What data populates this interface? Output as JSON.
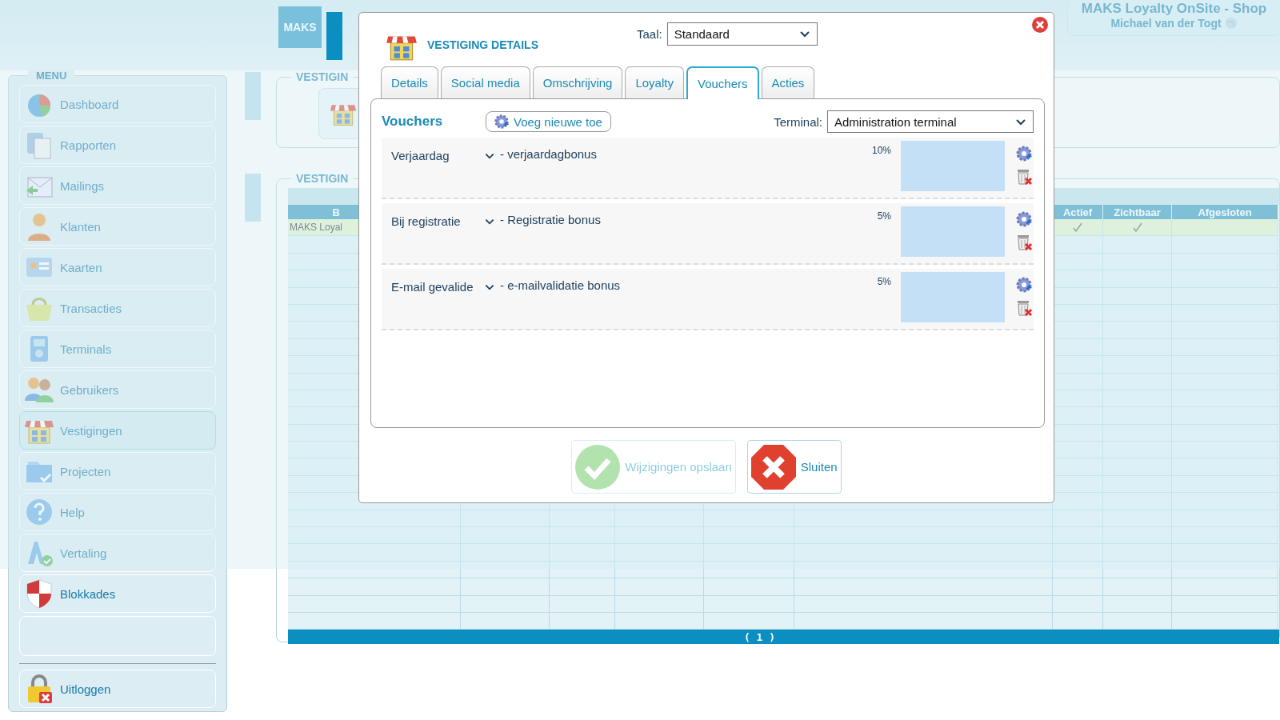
{
  "header": {
    "nav_button": "MAKS",
    "app_title": "MAKS Loyalty OnSite - Shop",
    "user_name": "Michael van der Togt"
  },
  "sidebar": {
    "title": "MENU",
    "items": [
      {
        "kind": "link",
        "label": "Dashboard",
        "selected": false
      },
      {
        "kind": "link",
        "label": "Rapporten",
        "selected": false
      },
      {
        "kind": "link",
        "label": "Mailings",
        "selected": false
      },
      {
        "kind": "link",
        "label": "Klanten",
        "selected": false
      },
      {
        "kind": "link",
        "label": "Kaarten",
        "selected": false
      },
      {
        "kind": "link",
        "label": "Transacties",
        "selected": false
      },
      {
        "kind": "link",
        "label": "Terminals",
        "selected": false
      },
      {
        "kind": "link",
        "label": "Gebruikers",
        "selected": false
      },
      {
        "kind": "link",
        "label": "Vestigingen",
        "selected": true
      },
      {
        "kind": "link",
        "label": "Projecten",
        "selected": false
      },
      {
        "kind": "link",
        "label": "Help",
        "selected": false
      },
      {
        "kind": "link",
        "label": "Vertaling",
        "selected": false
      },
      {
        "kind": "link",
        "label": "Blokkades",
        "selected": false
      },
      {
        "kind": "blank"
      },
      {
        "kind": "logout",
        "label": "Uitloggen",
        "selected": false
      }
    ]
  },
  "main": {
    "sections": [
      {
        "legend": "VESTIGIN"
      },
      {
        "legend": "VESTIGIN"
      }
    ],
    "table": {
      "first_header": "B",
      "headers": [
        "Actief",
        "Zichtbaar",
        "Afgesloten"
      ],
      "rows": [
        {
          "cell_1": "MAKS Loyal",
          "actief": true,
          "zichtbaar": true,
          "selected": true
        }
      ],
      "pager": "( 1 )"
    }
  },
  "dialog": {
    "title": "VESTIGING DETAILS",
    "language_label": "Taal:",
    "language": "Standaard",
    "tabs": [
      {
        "label": "Details",
        "selected": false
      },
      {
        "label": "Social media",
        "selected": false
      },
      {
        "label": "Omschrijving",
        "selected": false
      },
      {
        "label": "Loyalty",
        "selected": false
      },
      {
        "label": "Vouchers",
        "selected": true
      },
      {
        "label": "Acties",
        "selected": false
      }
    ],
    "panel": {
      "heading": "Vouchers",
      "add_button": "Voeg nieuwe toe",
      "terminal_label": "Terminal:",
      "terminal": "Administration terminal",
      "vouchers": [
        {
          "type": "Verjaardag",
          "description": "- verjaardagbonus",
          "percent": "10%"
        },
        {
          "type": "Bij registratie",
          "description": "- Registratie bonus",
          "percent": "5%"
        },
        {
          "type": "E-mail gevalide",
          "description": "- e-mailvalidatie bonus",
          "percent": "5%"
        }
      ]
    },
    "buttons": [
      {
        "kind": "save",
        "label": "Wijzigingen opslaan",
        "disabled": true
      },
      {
        "kind": "close",
        "label": "Sluiten",
        "disabled": false
      }
    ]
  }
}
